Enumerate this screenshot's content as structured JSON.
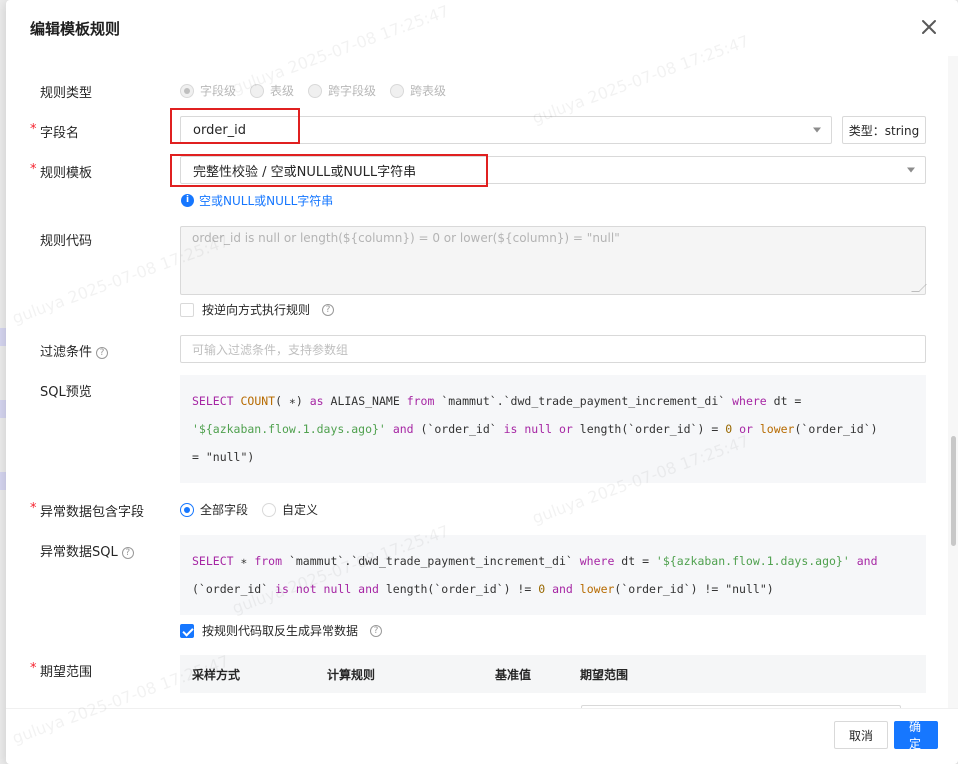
{
  "modal": {
    "title": "编辑模板规则"
  },
  "fields": {
    "rule_type": {
      "label": "规则类型",
      "options": [
        "字段级",
        "表级",
        "跨字段级",
        "跨表级"
      ],
      "selected": "字段级"
    },
    "field_name": {
      "label": "字段名",
      "value": "order_id",
      "type_text": "类型：string"
    },
    "rule_template": {
      "label": "规则模板",
      "value": "完整性校验 / 空或NULL或NULL字符串",
      "info": "空或NULL或NULL字符串"
    },
    "rule_code": {
      "label": "规则代码",
      "value": "order_id is null or length(${column}) = 0 or lower(${column}) = \"null\"",
      "reverse_label": "按逆向方式执行规则"
    },
    "filter": {
      "label": "过滤条件",
      "placeholder": "可输入过滤条件，支持参数组"
    },
    "sql_preview": {
      "label": "SQL预览"
    },
    "abnormal_fields": {
      "label": "异常数据包含字段",
      "options": [
        "全部字段",
        "自定义"
      ],
      "selected": "全部字段"
    },
    "abnormal_sql": {
      "label": "异常数据SQL",
      "invert_label": "按规则代码取反生成异常数据",
      "invert_checked": true
    },
    "expected_range": {
      "label": "期望范围",
      "columns": [
        "采样方式",
        "计算规则",
        "基准值",
        "期望范围"
      ]
    }
  },
  "footer": {
    "cancel": "取消",
    "ok": "确定"
  },
  "watermark": "guluya 2025-07-08 17:25:47"
}
